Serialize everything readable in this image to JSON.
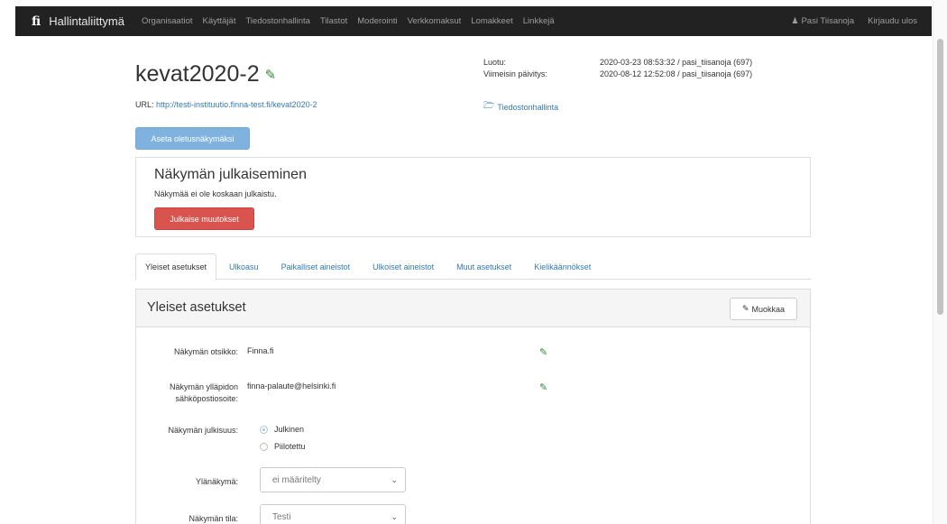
{
  "navbar": {
    "logo": "fi",
    "brand": "Hallintaliittymä",
    "items": [
      "Organisaatiot",
      "Käyttäjät",
      "Tiedostonhallinta",
      "Tilastot",
      "Moderointi",
      "Verkkomaksut",
      "Lomakkeet",
      "Linkkejä"
    ],
    "user": "Pasi Tiisanoja",
    "logout": "Kirjaudu ulos"
  },
  "header": {
    "title": "kevat2020-2",
    "url_label": "URL:",
    "url": "http://testi-instituutio.finna-test.fi/kevat2020-2",
    "created_label": "Luotu:",
    "created_value": "2020-03-23 08:53:32 / pasi_tiisanoja (697)",
    "updated_label": "Viimeisin päivitys:",
    "updated_value": "2020-08-12 12:52:08 / pasi_tiisanoja (697)",
    "files_link": "Tiedostonhallinta",
    "default_view_button": "Aseta oletusnäkymäksi"
  },
  "publish": {
    "title": "Näkymän julkaiseminen",
    "subtitle": "Näkymää ei ole koskaan julkaistu.",
    "button": "Julkaise muutokset"
  },
  "tabs": [
    "Yleiset asetukset",
    "Ulkoasu",
    "Paikalliset aineistot",
    "Ulkoiset aineistot",
    "Muut asetukset",
    "Kielikäännökset"
  ],
  "settings": {
    "title": "Yleiset asetukset",
    "edit_button": "Muokkaa",
    "view_title_label": "Näkymän otsikko:",
    "view_title_value": "Finna.fi",
    "admin_email_label_1": "Näkymän ylläpidon",
    "admin_email_label_2": "sähköpostiosoite:",
    "admin_email_value": "finna-palaute@helsinki.fi",
    "visibility_label": "Näkymän julkisuus:",
    "visibility_public": "Julkinen",
    "visibility_hidden": "Piilotettu",
    "parent_view_label": "Ylänäkymä:",
    "parent_view_value": "ei määritelty",
    "state_label": "Näkymän tila:",
    "state_value": "Testi"
  },
  "colors": {
    "navbar_bg": "#222222",
    "link": "#337ab7",
    "danger": "#d9534f",
    "primary_disabled": "#7fb2de",
    "edit_icon": "#2e8b2e"
  }
}
